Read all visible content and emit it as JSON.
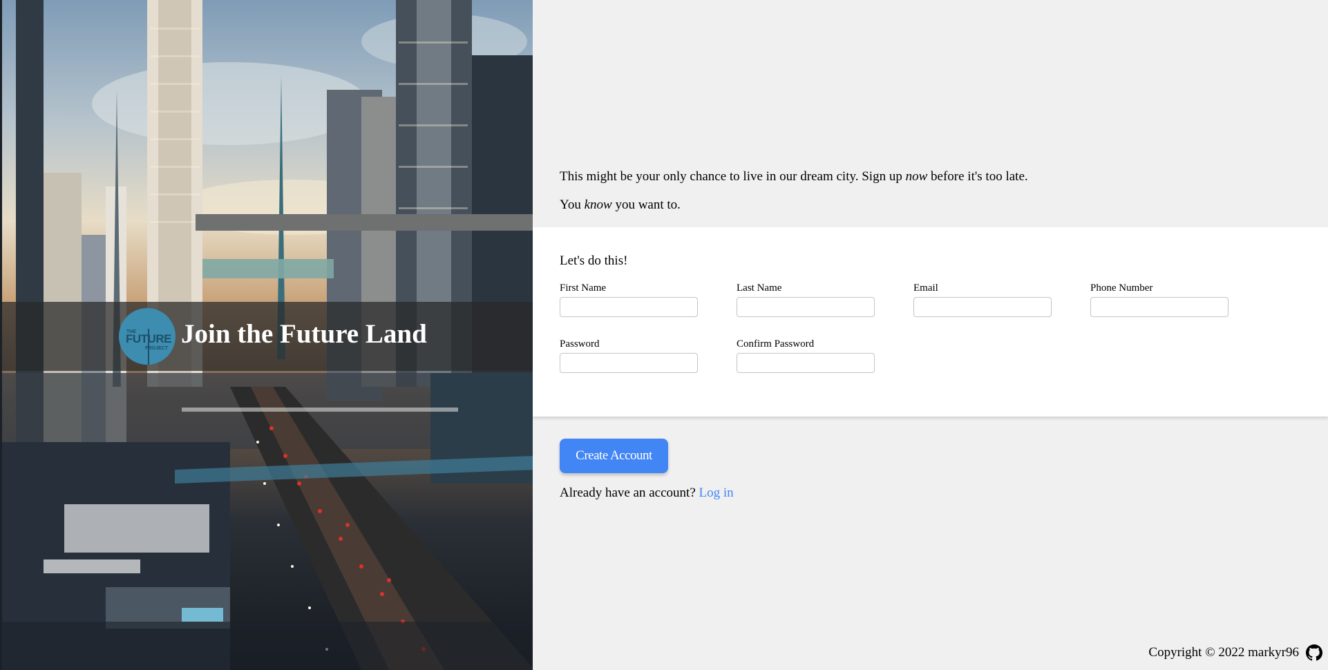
{
  "hero": {
    "title": "Join the Future Land",
    "logo_text": "THE FUTURE PROJECT"
  },
  "intro": {
    "line1_before": "This might be your only chance to live in our dream city. Sign up ",
    "line1_emph": "now",
    "line1_after": " before it's too late.",
    "line2_before": "You ",
    "line2_emph": "know",
    "line2_after": " you want to."
  },
  "form": {
    "heading": "Let's do this!",
    "fields": {
      "first_name": {
        "label": "First Name",
        "value": ""
      },
      "last_name": {
        "label": "Last Name",
        "value": ""
      },
      "email": {
        "label": "Email",
        "value": ""
      },
      "phone": {
        "label": "Phone Number",
        "value": ""
      },
      "password": {
        "label": "Password",
        "value": ""
      },
      "confirm_password": {
        "label": "Confirm Password",
        "value": ""
      }
    },
    "submit_label": "Create Account"
  },
  "login": {
    "prompt": "Already have an account?",
    "link_label": "Log in"
  },
  "footer": {
    "copyright": "Copyright © 2022 markyr96",
    "icon": "github-icon"
  },
  "colors": {
    "accent": "#4285f4",
    "page_bg": "#f0f0f0",
    "panel_bg": "#ffffff",
    "logo_bg": "#3d8db1"
  }
}
